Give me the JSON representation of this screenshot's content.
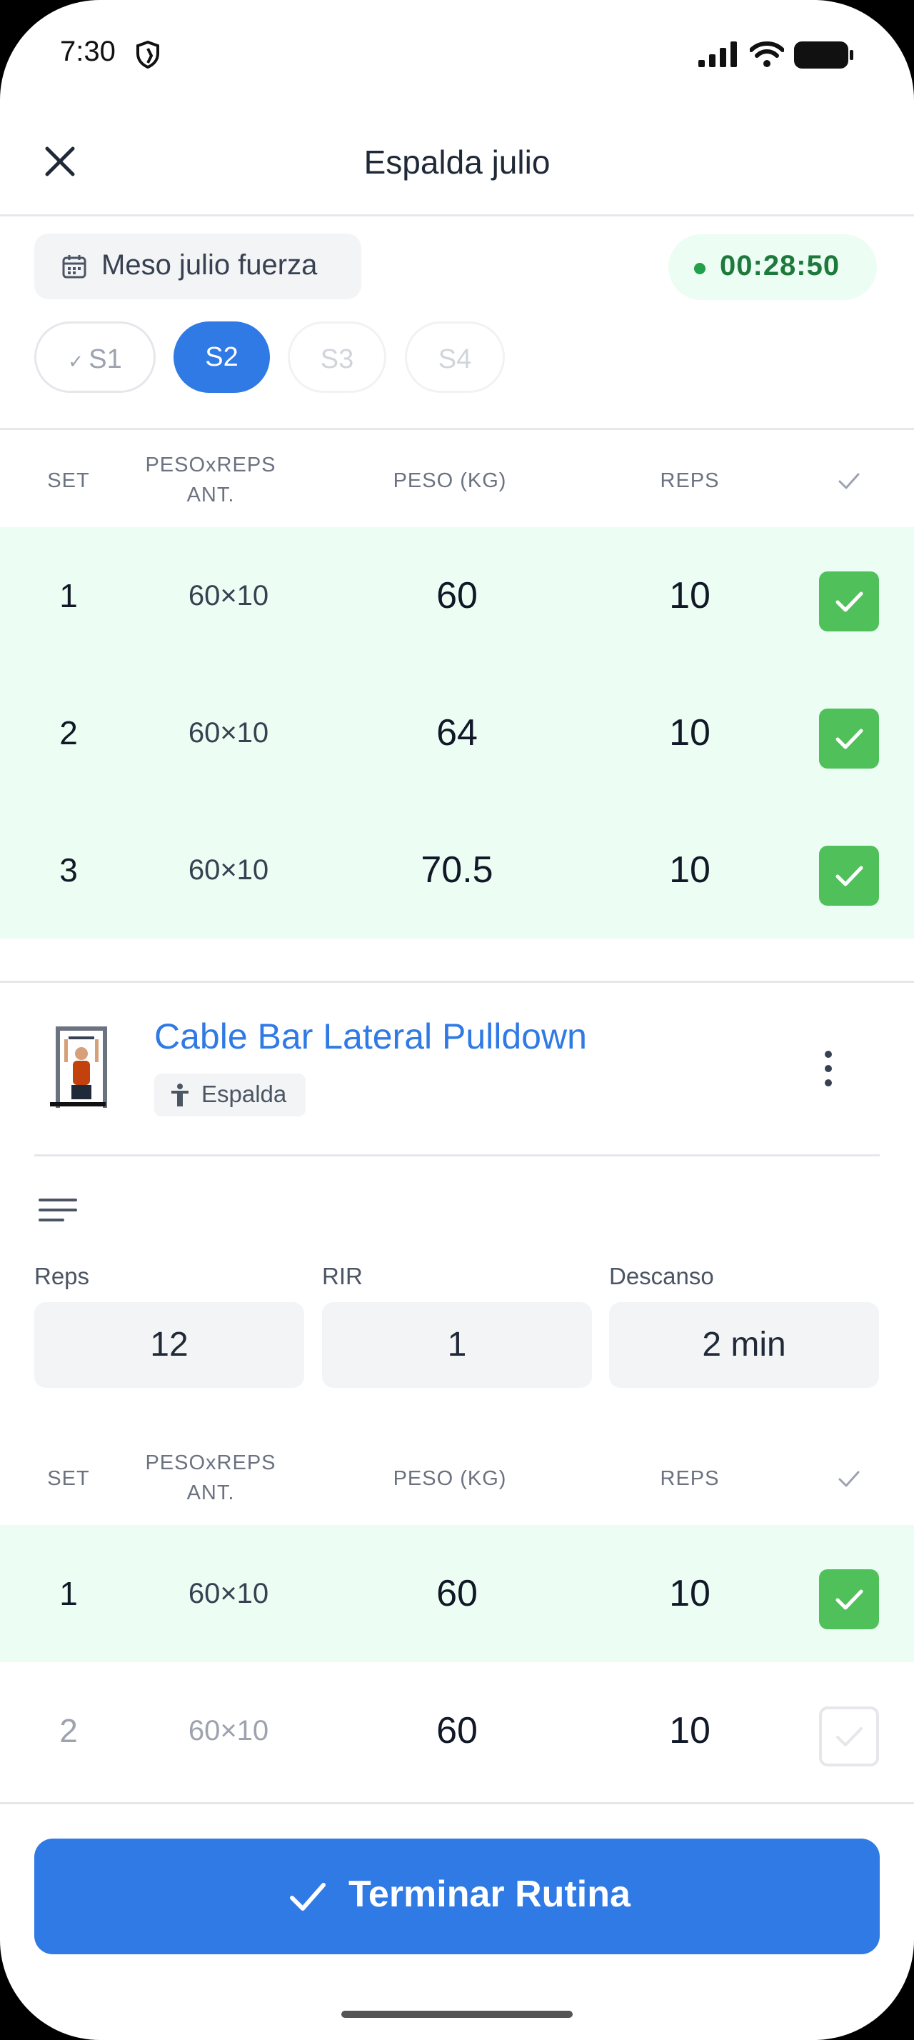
{
  "status_bar": {
    "time": "7:30"
  },
  "header": {
    "title": "Espalda julio"
  },
  "meso": {
    "label": "Meso julio fuerza"
  },
  "timer": {
    "value": "00:28:50"
  },
  "sessions": [
    {
      "label": "S1",
      "state": "done"
    },
    {
      "label": "S2",
      "state": "active"
    },
    {
      "label": "S3",
      "state": "future"
    },
    {
      "label": "S4",
      "state": "future"
    }
  ],
  "table_headers": {
    "set": "SET",
    "prev_line1": "PESOxREPS",
    "prev_line2": "ANT.",
    "peso": "PESO (KG)",
    "reps": "REPS"
  },
  "exercise1": {
    "sets": [
      {
        "set": "1",
        "prev": "60×10",
        "peso": "60",
        "reps": "10",
        "done": true
      },
      {
        "set": "2",
        "prev": "60×10",
        "peso": "64",
        "reps": "10",
        "done": true
      },
      {
        "set": "3",
        "prev": "60×10",
        "peso": "70.5",
        "reps": "10",
        "done": true
      }
    ]
  },
  "exercise2": {
    "name": "Cable Bar Lateral Pulldown",
    "muscle": "Espalda",
    "targets": {
      "reps_label": "Reps",
      "reps_value": "12",
      "rir_label": "RIR",
      "rir_value": "1",
      "rest_label": "Descanso",
      "rest_value": "2 min"
    },
    "sets": [
      {
        "set": "1",
        "prev": "60×10",
        "peso": "60",
        "reps": "10",
        "done": true
      },
      {
        "set": "2",
        "prev": "60×10",
        "peso": "60",
        "reps": "10",
        "done": false
      }
    ]
  },
  "cta": {
    "label": "Terminar Rutina"
  },
  "colors": {
    "accent": "#2f7ae5",
    "success": "#4fc05a",
    "done_row_bg": "#ecfdf3",
    "timer_text": "#1e7a3c"
  }
}
